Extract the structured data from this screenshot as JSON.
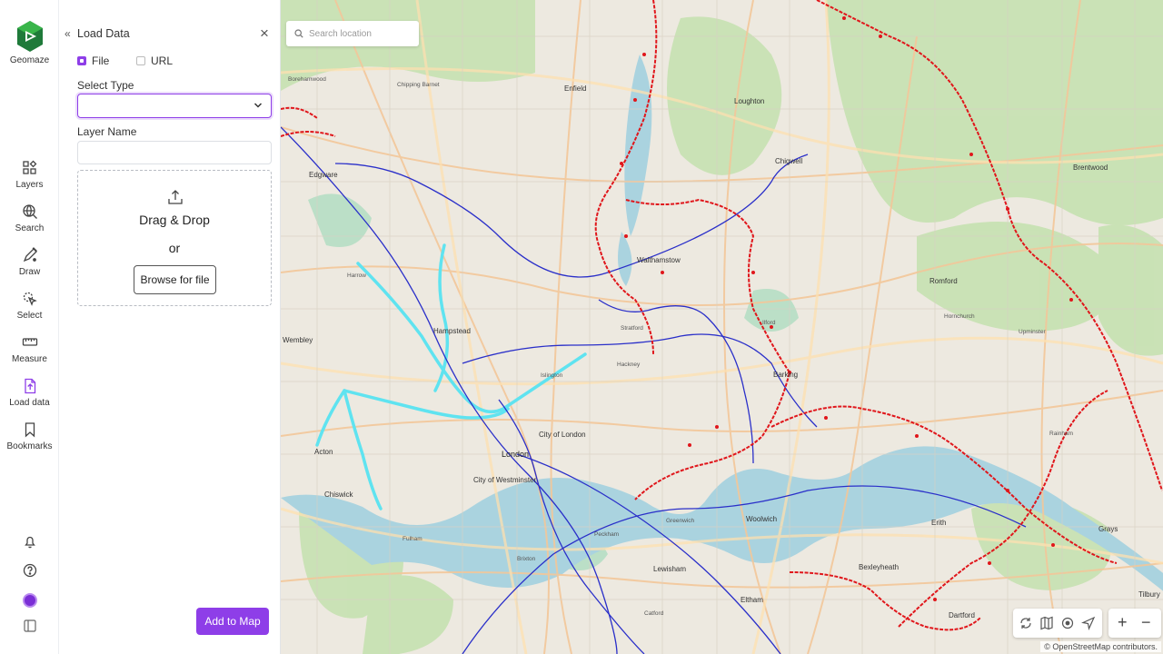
{
  "app": {
    "name": "Geomaze"
  },
  "rail": {
    "items": [
      {
        "label": "Layers",
        "icon": "layers-icon"
      },
      {
        "label": "Search",
        "icon": "search-globe-icon"
      },
      {
        "label": "Draw",
        "icon": "draw-icon"
      },
      {
        "label": "Select",
        "icon": "select-icon"
      },
      {
        "label": "Measure",
        "icon": "ruler-icon"
      },
      {
        "label": "Load data",
        "icon": "load-data-icon"
      },
      {
        "label": "Bookmarks",
        "icon": "bookmark-icon"
      }
    ],
    "bottom_icons": [
      "bell-icon",
      "help-icon",
      "avatar",
      "sidebar-toggle-icon"
    ]
  },
  "panel": {
    "collapse_glyph": "«",
    "title": "Load Data",
    "close_glyph": "×",
    "source_options": [
      {
        "label": "File",
        "checked": true
      },
      {
        "label": "URL",
        "checked": false
      }
    ],
    "select_type_label": "Select Type",
    "select_type_value": "",
    "layer_name_label": "Layer Name",
    "layer_name_value": "",
    "dropzone": {
      "drag_text": "Drag & Drop",
      "or_text": "or",
      "browse_label": "Browse for file"
    },
    "add_button": "Add to Map"
  },
  "map": {
    "search_placeholder": "Search location",
    "attribution": "© OpenStreetMap contributors.",
    "zoom_in": "+",
    "zoom_out": "−",
    "labels": {
      "london": "London",
      "city_of_london": "City of London",
      "city_of_westminster": "City of Westminster",
      "chigwell": "Chigwell",
      "romford": "Romford",
      "barking": "Barking",
      "enfield": "Enfield",
      "brentwood": "Brentwood",
      "dartford": "Dartford",
      "erith": "Erith",
      "woolwich": "Woolwich",
      "walthamstow": "Walthamstow",
      "hampstead": "Hampstead",
      "acton": "Acton",
      "edgware": "Edgware",
      "bexleyheath": "Bexleyheath",
      "lewisham": "Lewisham",
      "tilbury": "Tilbury",
      "loughton": "Loughton",
      "wembley": "Wembley",
      "chiswick": "Chiswick",
      "stratford": "Stratford",
      "harrow": "Harrow",
      "barnet": "Chipping Barnet",
      "islington": "Islington",
      "greenwich": "Greenwich",
      "eltham": "Eltham",
      "hornchurch": "Hornchurch",
      "ilford": "Ilford",
      "hackney": "Hackney",
      "peckham": "Peckham",
      "brixton": "Brixton",
      "fulham": "Fulham",
      "catford": "Catford",
      "rainham": "Rainham",
      "upminster": "Upminster",
      "grays": "Grays",
      "borehamwood": "Borehamwood"
    }
  },
  "colors": {
    "accent": "#8e3ee8",
    "route_red": "#e0161b",
    "route_blue": "#2a2fc9",
    "route_cyan": "#5fe3f0",
    "water": "#aad3df",
    "park": "#c8e2b3"
  }
}
